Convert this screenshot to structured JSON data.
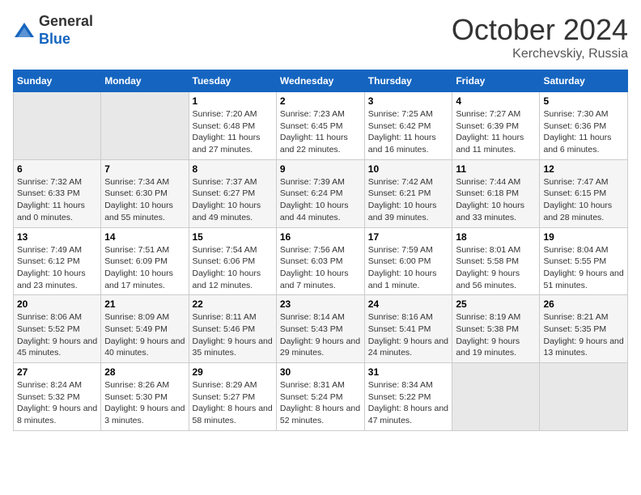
{
  "header": {
    "logo_line1": "General",
    "logo_line2": "Blue",
    "month": "October 2024",
    "location": "Kerchevskiy, Russia"
  },
  "weekdays": [
    "Sunday",
    "Monday",
    "Tuesday",
    "Wednesday",
    "Thursday",
    "Friday",
    "Saturday"
  ],
  "weeks": [
    [
      {
        "day": "",
        "empty": true
      },
      {
        "day": "",
        "empty": true
      },
      {
        "day": "1",
        "sunrise": "7:20 AM",
        "sunset": "6:48 PM",
        "daylight": "11 hours and 27 minutes."
      },
      {
        "day": "2",
        "sunrise": "7:23 AM",
        "sunset": "6:45 PM",
        "daylight": "11 hours and 22 minutes."
      },
      {
        "day": "3",
        "sunrise": "7:25 AM",
        "sunset": "6:42 PM",
        "daylight": "11 hours and 16 minutes."
      },
      {
        "day": "4",
        "sunrise": "7:27 AM",
        "sunset": "6:39 PM",
        "daylight": "11 hours and 11 minutes."
      },
      {
        "day": "5",
        "sunrise": "7:30 AM",
        "sunset": "6:36 PM",
        "daylight": "11 hours and 6 minutes."
      }
    ],
    [
      {
        "day": "6",
        "sunrise": "7:32 AM",
        "sunset": "6:33 PM",
        "daylight": "11 hours and 0 minutes."
      },
      {
        "day": "7",
        "sunrise": "7:34 AM",
        "sunset": "6:30 PM",
        "daylight": "10 hours and 55 minutes."
      },
      {
        "day": "8",
        "sunrise": "7:37 AM",
        "sunset": "6:27 PM",
        "daylight": "10 hours and 49 minutes."
      },
      {
        "day": "9",
        "sunrise": "7:39 AM",
        "sunset": "6:24 PM",
        "daylight": "10 hours and 44 minutes."
      },
      {
        "day": "10",
        "sunrise": "7:42 AM",
        "sunset": "6:21 PM",
        "daylight": "10 hours and 39 minutes."
      },
      {
        "day": "11",
        "sunrise": "7:44 AM",
        "sunset": "6:18 PM",
        "daylight": "10 hours and 33 minutes."
      },
      {
        "day": "12",
        "sunrise": "7:47 AM",
        "sunset": "6:15 PM",
        "daylight": "10 hours and 28 minutes."
      }
    ],
    [
      {
        "day": "13",
        "sunrise": "7:49 AM",
        "sunset": "6:12 PM",
        "daylight": "10 hours and 23 minutes."
      },
      {
        "day": "14",
        "sunrise": "7:51 AM",
        "sunset": "6:09 PM",
        "daylight": "10 hours and 17 minutes."
      },
      {
        "day": "15",
        "sunrise": "7:54 AM",
        "sunset": "6:06 PM",
        "daylight": "10 hours and 12 minutes."
      },
      {
        "day": "16",
        "sunrise": "7:56 AM",
        "sunset": "6:03 PM",
        "daylight": "10 hours and 7 minutes."
      },
      {
        "day": "17",
        "sunrise": "7:59 AM",
        "sunset": "6:00 PM",
        "daylight": "10 hours and 1 minute."
      },
      {
        "day": "18",
        "sunrise": "8:01 AM",
        "sunset": "5:58 PM",
        "daylight": "9 hours and 56 minutes."
      },
      {
        "day": "19",
        "sunrise": "8:04 AM",
        "sunset": "5:55 PM",
        "daylight": "9 hours and 51 minutes."
      }
    ],
    [
      {
        "day": "20",
        "sunrise": "8:06 AM",
        "sunset": "5:52 PM",
        "daylight": "9 hours and 45 minutes."
      },
      {
        "day": "21",
        "sunrise": "8:09 AM",
        "sunset": "5:49 PM",
        "daylight": "9 hours and 40 minutes."
      },
      {
        "day": "22",
        "sunrise": "8:11 AM",
        "sunset": "5:46 PM",
        "daylight": "9 hours and 35 minutes."
      },
      {
        "day": "23",
        "sunrise": "8:14 AM",
        "sunset": "5:43 PM",
        "daylight": "9 hours and 29 minutes."
      },
      {
        "day": "24",
        "sunrise": "8:16 AM",
        "sunset": "5:41 PM",
        "daylight": "9 hours and 24 minutes."
      },
      {
        "day": "25",
        "sunrise": "8:19 AM",
        "sunset": "5:38 PM",
        "daylight": "9 hours and 19 minutes."
      },
      {
        "day": "26",
        "sunrise": "8:21 AM",
        "sunset": "5:35 PM",
        "daylight": "9 hours and 13 minutes."
      }
    ],
    [
      {
        "day": "27",
        "sunrise": "8:24 AM",
        "sunset": "5:32 PM",
        "daylight": "9 hours and 8 minutes."
      },
      {
        "day": "28",
        "sunrise": "8:26 AM",
        "sunset": "5:30 PM",
        "daylight": "9 hours and 3 minutes."
      },
      {
        "day": "29",
        "sunrise": "8:29 AM",
        "sunset": "5:27 PM",
        "daylight": "8 hours and 58 minutes."
      },
      {
        "day": "30",
        "sunrise": "8:31 AM",
        "sunset": "5:24 PM",
        "daylight": "8 hours and 52 minutes."
      },
      {
        "day": "31",
        "sunrise": "8:34 AM",
        "sunset": "5:22 PM",
        "daylight": "8 hours and 47 minutes."
      },
      {
        "day": "",
        "empty": true
      },
      {
        "day": "",
        "empty": true
      }
    ]
  ],
  "labels": {
    "sunrise": "Sunrise:",
    "sunset": "Sunset:",
    "daylight": "Daylight:"
  }
}
